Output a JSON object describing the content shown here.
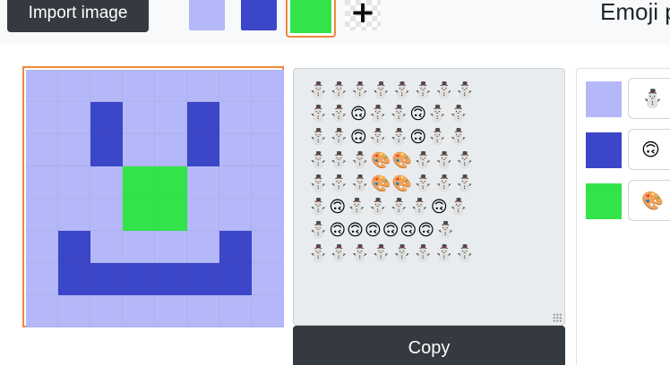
{
  "toolbar": {
    "import_label": "Import image",
    "add_icon": "plus-icon",
    "plus_glyph": "+",
    "heading": "Emoji p",
    "palette": [
      {
        "color": "#b4b8f8",
        "selected": false
      },
      {
        "color": "#3c46c8",
        "selected": false
      },
      {
        "color": "#32e44a",
        "selected": true
      }
    ]
  },
  "pixel_grid": {
    "rows": 8,
    "cols": 8,
    "colors": [
      "#b4b8f8",
      "#3c46c8",
      "#32e44a"
    ],
    "cells": [
      [
        0,
        0,
        0,
        0,
        0,
        0,
        0,
        0
      ],
      [
        0,
        0,
        1,
        0,
        0,
        1,
        0,
        0
      ],
      [
        0,
        0,
        1,
        0,
        0,
        1,
        0,
        0
      ],
      [
        0,
        0,
        0,
        2,
        2,
        0,
        0,
        0
      ],
      [
        0,
        0,
        0,
        2,
        2,
        0,
        0,
        0
      ],
      [
        0,
        1,
        0,
        0,
        0,
        0,
        1,
        0
      ],
      [
        0,
        1,
        1,
        1,
        1,
        1,
        1,
        0
      ],
      [
        0,
        0,
        0,
        0,
        0,
        0,
        0,
        0
      ]
    ]
  },
  "emoji_output": {
    "rows": [
      "⛄⛄⛄⛄⛄⛄⛄⛄",
      "⛄⛄🙃⛄⛄🙃⛄⛄",
      "⛄⛄🙃⛄⛄🙃⛄⛄",
      "⛄⛄⛄🎨🎨⛄⛄⛄",
      "⛄⛄⛄🎨🎨⛄⛄⛄",
      "⛄🙃⛄⛄⛄⛄🙃⛄",
      "⛄🙃🙃🙃🙃🙃🙃⛄",
      "⛄⛄⛄⛄⛄⛄⛄⛄"
    ],
    "copy_label": "Copy"
  },
  "mappings": [
    {
      "color": "#b4b8f8",
      "emoji": "⛄"
    },
    {
      "color": "#3c46c8",
      "emoji": "🙃"
    },
    {
      "color": "#32e44a",
      "emoji": "🎨"
    }
  ]
}
